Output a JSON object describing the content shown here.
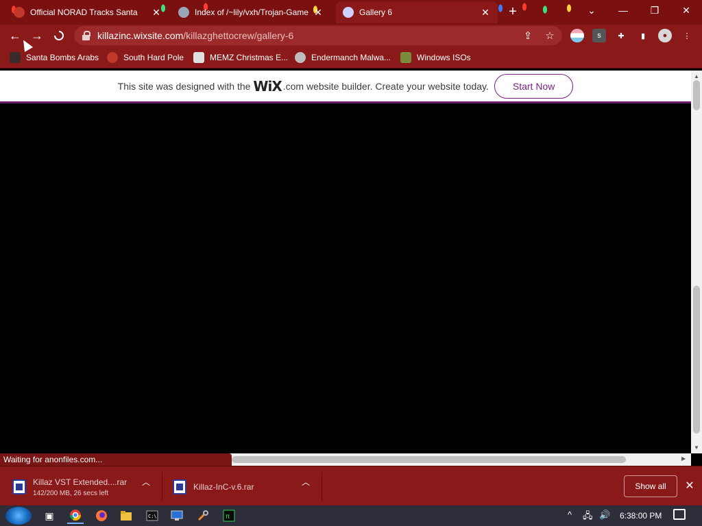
{
  "tabs": [
    {
      "title": "Official NORAD Tracks Santa",
      "close": "✕",
      "active": false
    },
    {
      "title": "Index of /~lily/vxh/Trojan-Game",
      "close": "✕",
      "active": false
    },
    {
      "title": "Gallery 6",
      "close": "✕",
      "active": true
    }
  ],
  "toolbar": {
    "url_host": "killazinc.wixsite.com",
    "url_path": "/killazghettocrew/gallery-6",
    "ext_s": "s"
  },
  "bookmarks": [
    {
      "label": "Santa Bombs Arabs"
    },
    {
      "label": "South Hard Pole"
    },
    {
      "label": "MEMZ Christmas E..."
    },
    {
      "label": "Endermanch Malwa..."
    },
    {
      "label": "Windows ISOs"
    }
  ],
  "wix": {
    "text_before": "This site was designed with the",
    "logo": "WiX",
    "text_after": ".com website builder. Create your website today.",
    "button": "Start Now"
  },
  "status": "Waiting for anonfiles.com...",
  "downloads": [
    {
      "name": "Killaz VST Extended....rar",
      "sub": "142/200 MB, 26 secs left"
    },
    {
      "name": "Killaz-InC-v.6.rar",
      "sub": ""
    }
  ],
  "downloads_show_all": "Show all",
  "clock": "6:38:00 PM",
  "colors": {
    "chrome": "#8a1a1a",
    "wix_accent": "#7b1e82"
  }
}
